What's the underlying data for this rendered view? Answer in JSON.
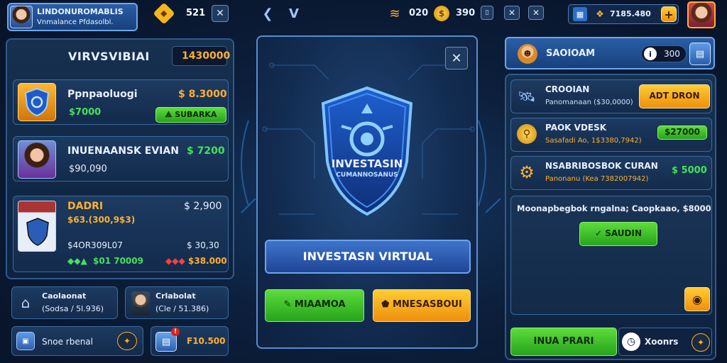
{
  "colors": {
    "accent": "#2f6fd0",
    "positive": "#43e35a",
    "warning": "#ffb02e",
    "negative": "#ff4040",
    "background": "#0c1f3c"
  },
  "topbar": {
    "profile_name": "LINDONUROMABLIS",
    "profile_sub": "Vnmalance Pfdasolbl.",
    "gold_value": "521",
    "stat1_value": "020",
    "stat2_value": "390",
    "currency_value": "7185.480",
    "icons": [
      "avatar-portrait",
      "diamond-icon",
      "close-icon",
      "back-chevron-icon",
      "down-chevron-icon",
      "signal-icon",
      "coin-icon",
      "tablet-icon",
      "close-icon",
      "close-icon",
      "calendar-icon",
      "coin-stack-icon",
      "plus-icon",
      "avatar-portrait"
    ]
  },
  "left": {
    "title": "VIRVSVIBIAI",
    "total": "1430000",
    "cards": [
      {
        "name": "Ppnpaoluogi",
        "value": "$ 8.3000",
        "sub": "$7000",
        "button": "SUBARKA",
        "icon": "shield-emblem-icon"
      },
      {
        "name": "INUENAANSK EVIAN",
        "value": "$ 7200",
        "sub": "$90,090",
        "icon": "avatar-portrait"
      },
      {
        "name": "DADRI",
        "value": "$ 2,900",
        "sub": "$63.(300,9$3)",
        "row_left": "$4OR309L07",
        "row_right": "$ 30,30",
        "stock_left": "$01 70009",
        "stock_right": "$38.000",
        "icon": "building-icon"
      }
    ],
    "bottom": [
      {
        "name": "Caolaonat",
        "sub": "(Sodsa / 5l.936)",
        "icon": "house-icon"
      },
      {
        "name": "Crlabolat",
        "sub": "(Cle / 51.386)",
        "icon": "person-icon"
      },
      {
        "name": "Snoe rbenal",
        "icon": "box-icon",
        "action_icon": "coin-icon"
      },
      {
        "name": "F10.500",
        "icon": "card-icon",
        "badge": "!"
      }
    ]
  },
  "center": {
    "emblem_title": "INVESTASIN",
    "emblem_sub": "CUMANNOSANUS",
    "main_button": "INVESTASN VIRTUAL",
    "left_button": "MIAAMOA",
    "right_button": "MNESASBOUI",
    "icons": [
      "shield-emblem-icon",
      "close-icon",
      "pencil-icon",
      "wallet-icon"
    ]
  },
  "right": {
    "header_name": "SAOIOAM",
    "header_count": "300",
    "items": [
      {
        "name": "CROOIAN",
        "sub": "Panomanaan ($30,0000)",
        "button": "ADT DRON",
        "icon": "satellite-icon"
      },
      {
        "name": "PAOK VDESK",
        "sub": "Sasafadi Ao, 1$3380,7942)",
        "value": "$27000",
        "icon": "search-icon"
      },
      {
        "name": "NSABRIBOSBOK CURAN",
        "sub": "Panonanu (Kea 7382007942)",
        "value": "$ 5000",
        "icon": "gear-icon"
      }
    ],
    "summary": "Moonapbegbok rngalna; Caopkaao, $8000",
    "summary_button": "SAUDIN",
    "footer_green": "INUA PRARI",
    "footer_label": "Xoonrs",
    "icons": [
      "avatar-icon",
      "book-icon",
      "info-icon",
      "coin-icon",
      "check-icon",
      "clock-icon",
      "coin-icon"
    ]
  }
}
